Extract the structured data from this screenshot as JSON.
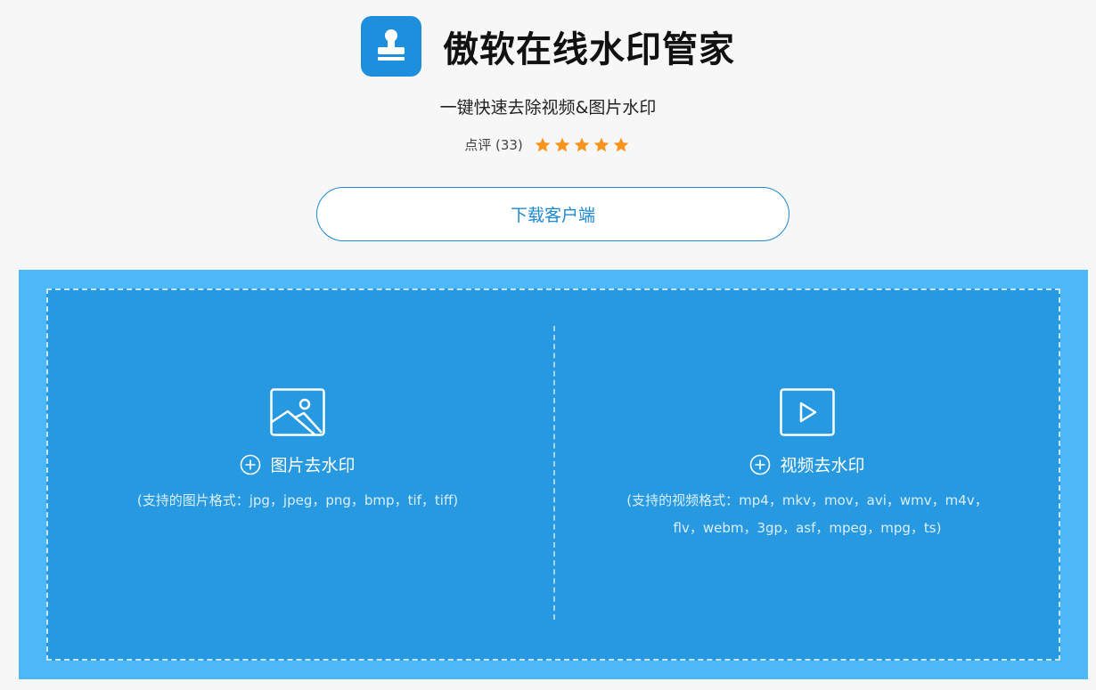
{
  "app": {
    "title": "傲软在线水印管家",
    "subtitle": "一键快速去除视频&图片水印",
    "icon": "stamp-icon",
    "brand_color": "#1e8fdc"
  },
  "rating": {
    "label": "点评 (33)",
    "stars": 5,
    "star_color": "#f7941d"
  },
  "download_button": {
    "label": "下载客户端"
  },
  "upload": {
    "background": "#4cb8f7",
    "zone_color": "#2799e0",
    "image": {
      "icon": "image-icon",
      "action_label": "图片去水印",
      "formats": "(支持的图片格式：jpg，jpeg，png，bmp，tif，tiff)"
    },
    "video": {
      "icon": "video-play-icon",
      "action_label": "视频去水印",
      "formats": "(支持的视频格式：mp4，mkv，mov，avi，wmv，m4v，flv，webm，3gp，asf，mpeg，mpg，ts)"
    }
  }
}
